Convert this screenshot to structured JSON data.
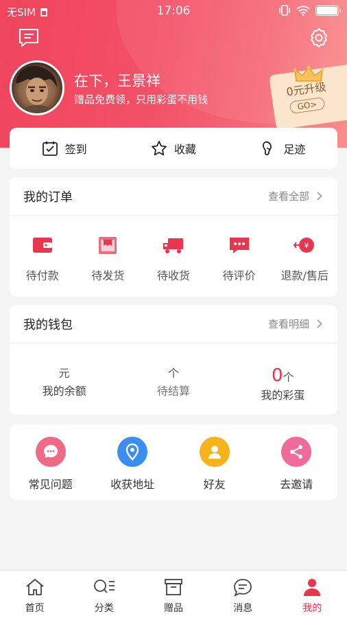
{
  "status_bar": {
    "carrier": "无SIM",
    "time": "17:06"
  },
  "profile": {
    "username": "在下，王景祥",
    "slogan": "赠品免费领，只用彩蛋不用钱"
  },
  "upgrade": {
    "title": "0元升级",
    "go_label": "GO>"
  },
  "quick_bar": [
    {
      "label": "签到",
      "icon": "calendar-check-icon"
    },
    {
      "label": "收藏",
      "icon": "star-icon"
    },
    {
      "label": "足迹",
      "icon": "footprint-icon"
    }
  ],
  "orders": {
    "title": "我的订单",
    "more": "查看全部",
    "items": [
      {
        "label": "待付款",
        "icon": "wallet-icon"
      },
      {
        "label": "待发货",
        "icon": "package-icon"
      },
      {
        "label": "待收货",
        "icon": "truck-icon"
      },
      {
        "label": "待评价",
        "icon": "comment-icon"
      },
      {
        "label": "退款/售后",
        "icon": "refund-icon"
      }
    ]
  },
  "wallet": {
    "title": "我的钱包",
    "more": "查看明细",
    "balance": {
      "value": "",
      "unit": "元",
      "label": "我的余额"
    },
    "pending": {
      "value": "",
      "unit": "个",
      "label": "待结算"
    },
    "eggs": {
      "value": "0",
      "unit": "个",
      "label": "我的彩蛋"
    }
  },
  "tools": [
    {
      "label": "常见问题",
      "icon": "faq-icon",
      "color": "#f06a86"
    },
    {
      "label": "收获地址",
      "icon": "location-icon",
      "color": "#3b8df0"
    },
    {
      "label": "好友",
      "icon": "friend-icon",
      "color": "#f7b21c"
    },
    {
      "label": "去邀请",
      "icon": "share-icon",
      "color": "#f06a9a"
    }
  ],
  "tabbar": [
    {
      "label": "首页",
      "icon": "home-icon"
    },
    {
      "label": "分类",
      "icon": "category-icon"
    },
    {
      "label": "赠品",
      "icon": "gift-box-icon"
    },
    {
      "label": "消息",
      "icon": "message-icon"
    },
    {
      "label": "我的",
      "icon": "user-icon",
      "active": true
    }
  ],
  "colors": {
    "accent": "#e8364f",
    "header_start": "#f0455c",
    "header_end": "#fb8e8a"
  }
}
